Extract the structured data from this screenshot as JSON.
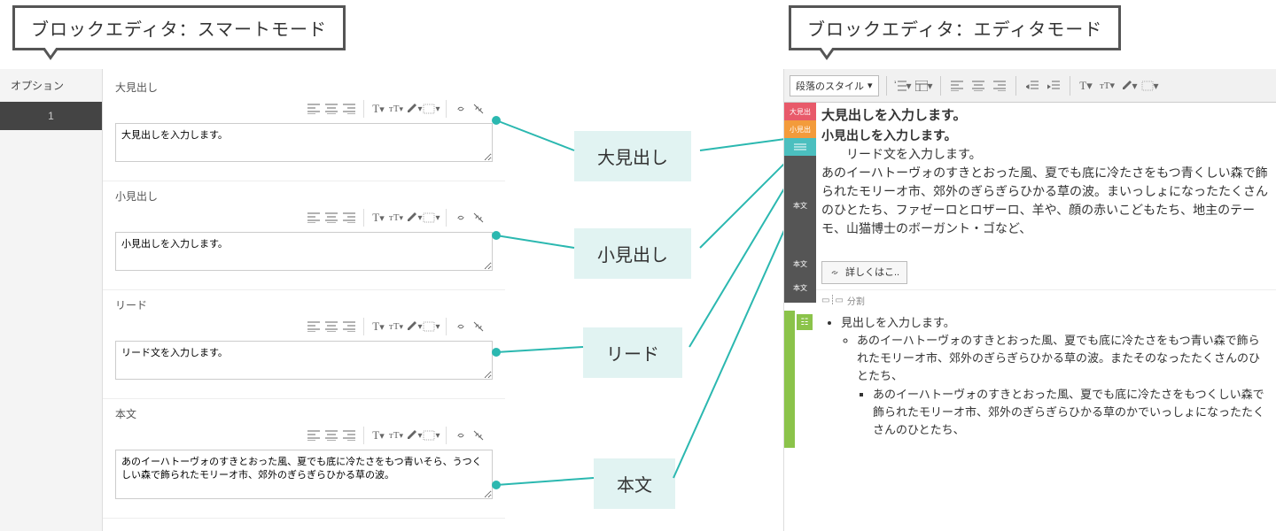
{
  "tabs": {
    "left_title": "ブロックエディタ：スマートモード",
    "right_title": "ブロックエディタ：エディタモード"
  },
  "sidebar": {
    "header": "オプション",
    "page": "1"
  },
  "blocks": {
    "h1": {
      "label": "大見出し",
      "value": "大見出しを入力します。"
    },
    "h2": {
      "label": "小見出し",
      "value": "小見出しを入力します。"
    },
    "lead": {
      "label": "リード",
      "value": "リード文を入力します。"
    },
    "body": {
      "label": "本文",
      "value": "あのイーハトーヴォのすきとおった風、夏でも底に冷たさをもつ青いそら、うつくしい森で飾られたモリーオ市、郊外のぎらぎらひかる草の波。"
    }
  },
  "center_labels": {
    "h1": "大見出し",
    "h2": "小見出し",
    "lead": "リード",
    "body": "本文"
  },
  "right": {
    "para_style_label": "段落のスタイル",
    "tags": {
      "h1": "大見出",
      "h2": "小見出",
      "body": "本文"
    },
    "h1": "大見出しを入力します。",
    "h2": "小見出しを入力します。",
    "lead": "　リード文を入力します。",
    "body": "あのイーハトーヴォのすきとおった風、夏でも底に冷たさをもつ青くしい森で飾られたモリーオ市、郊外のぎらぎらひかる草の波。まいっしょになったたくさんのひとたち、ファゼーロとロザーロ、羊や、顔の赤いこどもたち、地主のテーモ、山猫博士のボーガント・ゴなど、",
    "detail_btn": "詳しくはこ..",
    "split": "分割",
    "list": {
      "title": "見出しを入力します。",
      "li1": "あのイーハトーヴォのすきとおった風、夏でも底に冷たさをもつ青い森で飾られたモリーオ市、郊外のぎらぎらひかる草の波。またそのなったたくさんのひとたち、",
      "li2": "あのイーハトーヴォのすきとおった風、夏でも底に冷たさをもつくしい森で飾られたモリーオ市、郊外のぎらぎらひかる草のかでいっしょになったたくさんのひとたち、"
    }
  }
}
